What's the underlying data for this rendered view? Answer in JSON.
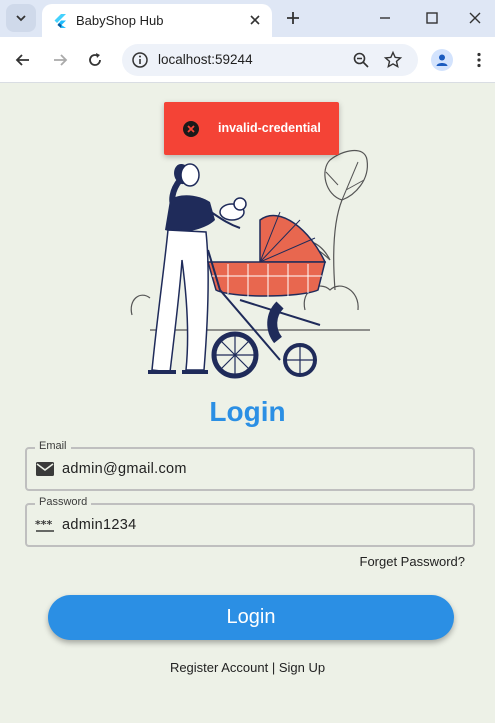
{
  "browser": {
    "tab_title": "BabyShop Hub",
    "url": "localhost:59244"
  },
  "toast": {
    "message": "invalid-credential",
    "color": "#f44336"
  },
  "login": {
    "title": "Login",
    "email_label": "Email",
    "email_value": "admin@gmail.com",
    "password_label": "Password",
    "password_value": "admin1234",
    "forget_password": "Forget Password?",
    "submit_label": "Login",
    "register_link": "Register Account | Sign Up"
  },
  "colors": {
    "accent": "#2b8fe4",
    "background": "#edf1e7",
    "error": "#f44336"
  }
}
